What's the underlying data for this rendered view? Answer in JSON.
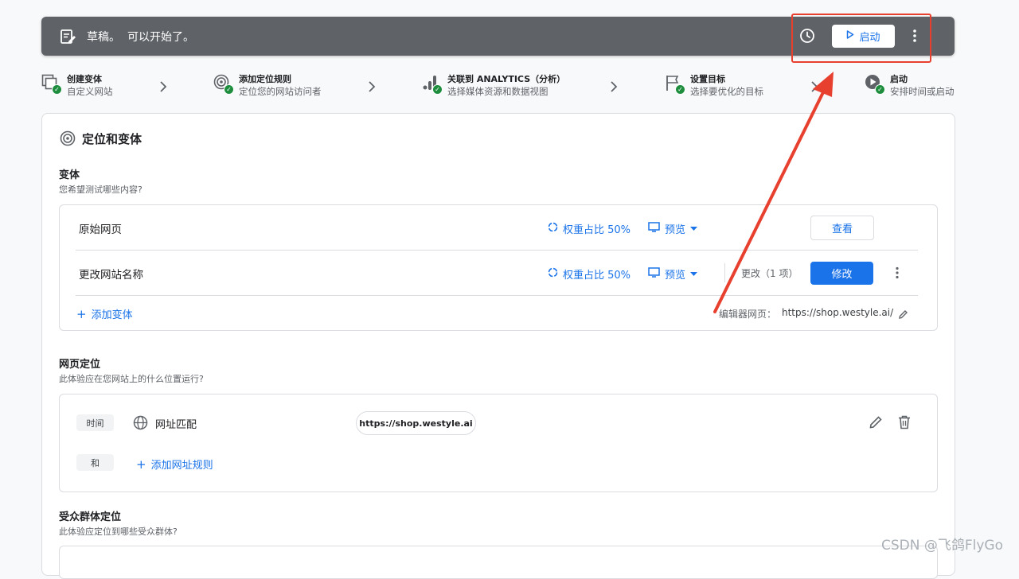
{
  "topbar": {
    "title": "草稿。",
    "subtitle": "可以开始了。",
    "launch_label": "启动",
    "accent": "#5f6368"
  },
  "steps": [
    {
      "title": "创建变体",
      "sub": "自定义网站",
      "icon": "copy-icon"
    },
    {
      "title": "添加定位规则",
      "sub": "定位您的网站访问者",
      "icon": "target-icon"
    },
    {
      "title": "关联到 ANALYTICS（分析）",
      "sub": "选择媒体资源和数据视图",
      "icon": "analytics-icon"
    },
    {
      "title": "设置目标",
      "sub": "选择要优化的目标",
      "icon": "flag-icon"
    },
    {
      "title": "启动",
      "sub": "安排时间或启动",
      "icon": "play-circle-icon"
    }
  ],
  "main": {
    "section_title": "定位和变体",
    "variants": {
      "title": "变体",
      "subtitle": "您希望测试哪些内容?",
      "rows": [
        {
          "name": "原始网页",
          "weight": "权重占比 50%",
          "preview": "预览",
          "action": "查看"
        },
        {
          "name": "更改网站名称",
          "weight": "权重占比 50%",
          "preview": "预览",
          "changes": "更改（1 项）",
          "action": "修改"
        }
      ],
      "add_label": "添加变体",
      "editor_label": "编辑器网页：",
      "editor_url": "https://shop.westyle.ai/"
    },
    "page_targeting": {
      "title": "网页定位",
      "subtitle": "此体验应在您网站上的什么位置运行?",
      "when_chip": "时间",
      "match_label": "网址匹配",
      "url": "https://shop.westyle.ai",
      "and_chip": "和",
      "add_rule_label": "添加网址规则"
    },
    "audience": {
      "title": "受众群体定位",
      "subtitle": "此体验应定位到哪些受众群体?"
    }
  },
  "watermark": "CSDN @飞鸽FlyGo",
  "colors": {
    "brand": "#1a73e8",
    "highlight": "#e8402f",
    "check": "#1e8e3e"
  }
}
